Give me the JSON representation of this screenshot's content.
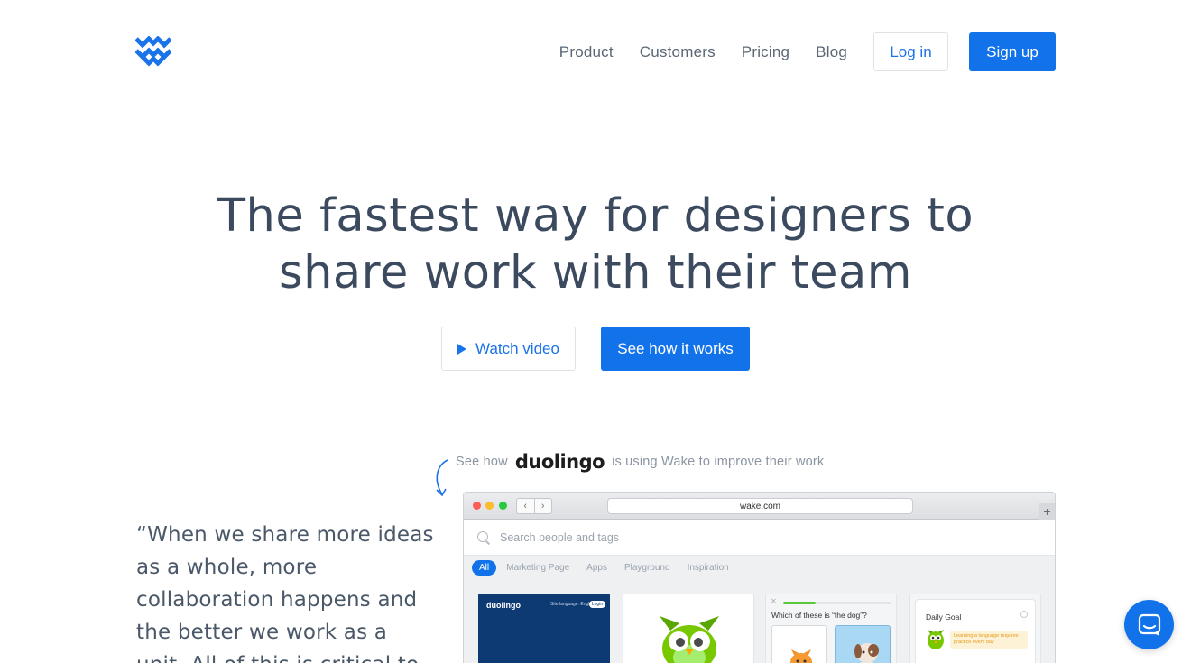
{
  "header": {
    "logo": "wake-logo-icon",
    "nav": [
      "Product",
      "Customers",
      "Pricing",
      "Blog"
    ],
    "login_label": "Log in",
    "signup_label": "Sign up"
  },
  "hero": {
    "title_line1": "The fastest way for designers to",
    "title_line2": "share work with their team",
    "watch_label": "Watch video",
    "how_label": "See how it works"
  },
  "promo": {
    "prefix": "See how",
    "brand": "duolingo",
    "suffix": "is using Wake to improve their work"
  },
  "quote": {
    "text": "“When we share more ideas as a whole, more collaboration happens and the better we work as a unit. All of this is critical to"
  },
  "browser": {
    "url": "wake.com",
    "search_placeholder": "Search people and tags",
    "tabs": [
      "All",
      "Marketing Page",
      "Apps",
      "Playground",
      "Inspiration"
    ],
    "active_tab": "All",
    "card1": {
      "brand": "duolingo",
      "menu": "Site language: English ∨",
      "button": "Login"
    },
    "card3": {
      "question": "Which of these is “the dog”?",
      "progress": 0.3
    },
    "card4": {
      "title": "Daily Goal",
      "message": "Learning a language requires practice every day"
    }
  },
  "colors": {
    "accent": "#1172ea",
    "text": "#3b4a5e",
    "muted": "#8a95a1"
  },
  "chat": {
    "icon": "chat-icon"
  }
}
